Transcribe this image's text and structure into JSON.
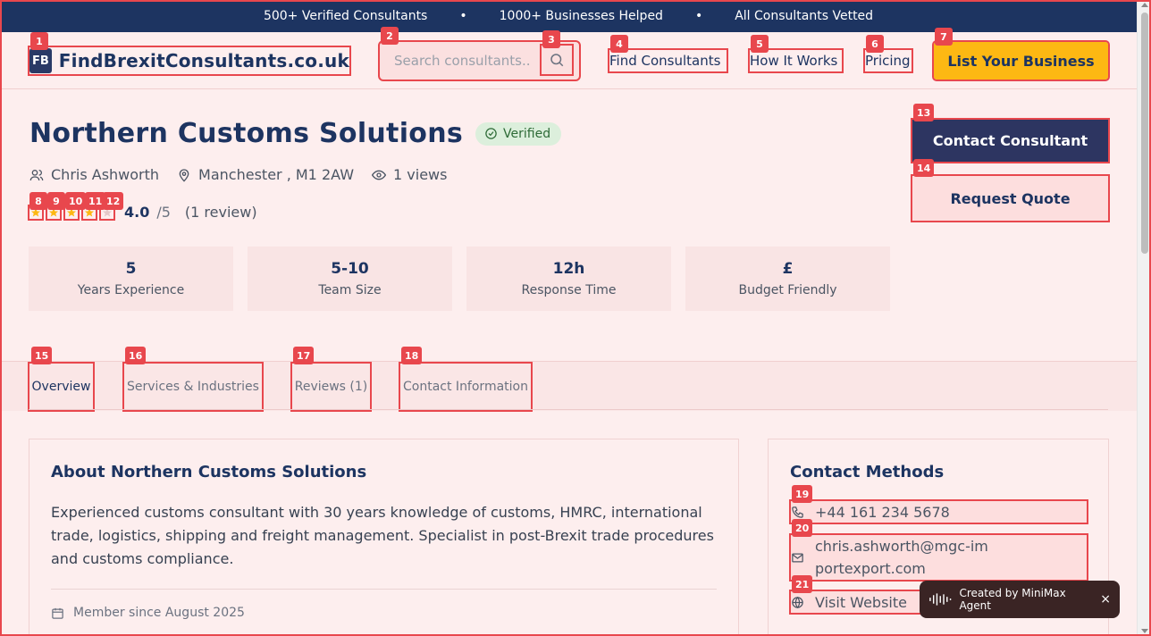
{
  "banner": {
    "item1": "500+ Verified Consultants",
    "sep": "•",
    "item2": "1000+ Businesses Helped",
    "item3": "All Consultants Vetted"
  },
  "header": {
    "logo_mark": "FB",
    "logo_text": "FindBrexitConsultants.co.uk",
    "search_placeholder": "Search consultants...",
    "nav": {
      "find": "Find Consultants",
      "how": "How It Works",
      "pricing": "Pricing"
    },
    "list_business": "List Your Business"
  },
  "profile": {
    "name": "Northern Customs Solutions",
    "verified": "Verified",
    "contact_person": "Chris Ashworth",
    "location": "Manchester , M1 2AW",
    "views": "1 views",
    "rating": {
      "value": "4.0",
      "max": "/5",
      "count": "(1 review)",
      "stars_filled": 4,
      "stars_total": 5
    },
    "cta_contact": "Contact Consultant",
    "cta_quote": "Request Quote"
  },
  "stats": [
    {
      "value": "5",
      "label": "Years Experience"
    },
    {
      "value": "5-10",
      "label": "Team Size"
    },
    {
      "value": "12h",
      "label": "Response Time"
    },
    {
      "value": "£",
      "label": "Budget Friendly"
    }
  ],
  "tabs": [
    {
      "label": "Overview"
    },
    {
      "label": "Services & Industries"
    },
    {
      "label": "Reviews (1)"
    },
    {
      "label": "Contact Information"
    }
  ],
  "about": {
    "heading": "About Northern Customs Solutions",
    "body": "Experienced customs consultant with 30 years knowledge of customs, HMRC, international trade, logistics, shipping and freight management. Specialist in post-Brexit trade procedures and customs compliance.",
    "member_since": "Member since August 2025"
  },
  "contact_methods": {
    "heading": "Contact Methods",
    "phone": "+44 161 234 5678",
    "email": "chris.ashworth@mgc-importexport.com",
    "website": "Visit Website"
  },
  "toast": {
    "text": "Created by MiniMax Agent",
    "close": "×"
  },
  "markers": [
    "1",
    "2",
    "3",
    "4",
    "5",
    "6",
    "7",
    "8",
    "9",
    "10",
    "11",
    "12",
    "13",
    "14",
    "15",
    "16",
    "17",
    "18",
    "19",
    "20",
    "21"
  ],
  "colors": {
    "navy": "#1d3461",
    "accent_yellow": "#fdb813",
    "marker_red": "#e8474d",
    "verified_green": "#2e6b37",
    "page_bg": "#fdeeee"
  }
}
